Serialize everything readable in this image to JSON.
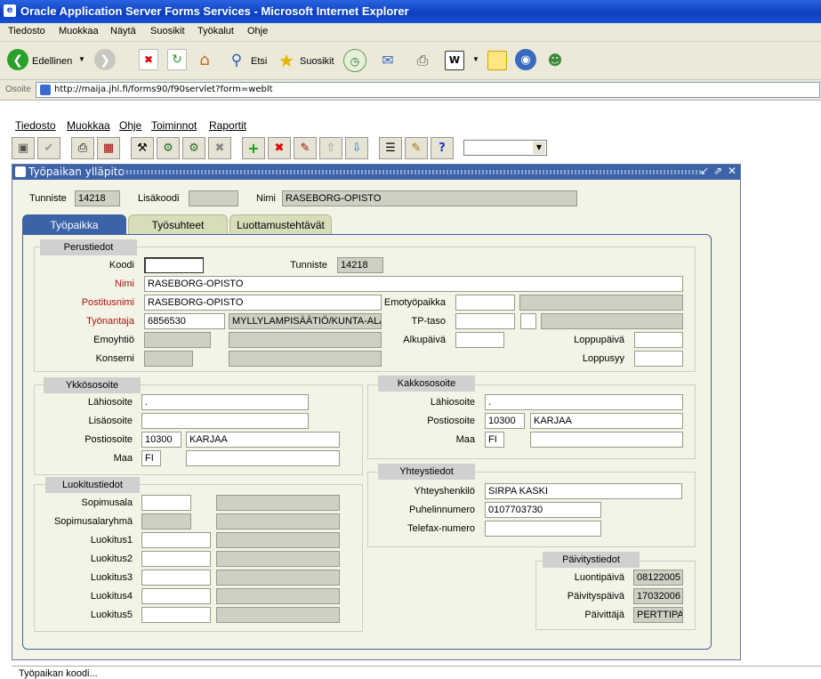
{
  "window": {
    "title": "Oracle Application Server Forms Services - Microsoft Internet Explorer"
  },
  "ie_menu": [
    "Tiedosto",
    "Muokkaa",
    "Näytä",
    "Suosikit",
    "Työkalut",
    "Ohje"
  ],
  "ie_toolbar": {
    "back": "Edellinen",
    "search": "Etsi",
    "favorites": "Suosikit"
  },
  "address": {
    "label": "Osoite",
    "url": "http://maija.jhl.fi/forms90/f90servlet?form=weblt"
  },
  "forms_menu": [
    {
      "label": "Tiedosto"
    },
    {
      "label": "Muokkaa"
    },
    {
      "label": "Ohje"
    },
    {
      "label": "Toiminnot"
    },
    {
      "label": "Raportit"
    }
  ],
  "form": {
    "title": "Työpaikan ylläpito",
    "header": {
      "tunniste_label": "Tunniste",
      "tunniste": "14218",
      "lisakoodi_label": "Lisäkoodi",
      "lisakoodi": "",
      "nimi_label": "Nimi",
      "nimi": "RASEBORG-OPISTO"
    },
    "tabs": [
      "Työpaikka",
      "Työsuhteet",
      "Luottamustehtävät"
    ],
    "perustiedot": {
      "title": "Perustiedot",
      "koodi_label": "Koodi",
      "koodi": "",
      "tunniste_label": "Tunniste",
      "tunniste": "14218",
      "nimi_label": "Nimi",
      "nimi": "RASEBORG-OPISTO",
      "postitusnimi_label": "Postitusnimi",
      "postitusnimi": "RASEBORG-OPISTO",
      "emotyopaikka_label": "Emotyöpaikka",
      "tyonantaja_label": "Työnantaja",
      "tyonantaja": "6856530",
      "tyonantaja_nimi": "MYLLYLAMPISÄÄTIÖ/KUNTA-ALA",
      "tptaso_label": "TP-taso",
      "emoyhtio_label": "Emoyhtiö",
      "alkupaiva_label": "Alkupäivä",
      "loppupaiva_label": "Loppupäivä",
      "konserni_label": "Konserni",
      "loppusyy_label": "Loppusyy"
    },
    "ykkososoite": {
      "title": "Ykkösosoite",
      "lahiosoite_label": "Lähiosoite",
      "lahiosoite": ".",
      "lisaosoite_label": "Lisäosoite",
      "lisaosoite": "",
      "postiosoite_label": "Postiosoite",
      "postinumero": "10300",
      "postitoimipaikka": "KARJAA",
      "maa_label": "Maa",
      "maa": "FI"
    },
    "kakkososoite": {
      "title": "Kakkososoite",
      "lahiosoite_label": "Lähiosoite",
      "lahiosoite": ".",
      "postiosoite_label": "Postiosoite",
      "postinumero": "10300",
      "postitoimipaikka": "KARJAA",
      "maa_label": "Maa",
      "maa": "FI"
    },
    "yhteystiedot": {
      "title": "Yhteystiedot",
      "yhteyshenkilo_label": "Yhteyshenkilö",
      "yhteyshenkilo": "SIRPA KASKI",
      "puhelin_label": "Puhelinnumero",
      "puhelin": "0107703730",
      "telefax_label": "Telefax-numero",
      "telefax": ""
    },
    "luokitustiedot": {
      "title": "Luokitustiedot",
      "sopimusala_label": "Sopimusala",
      "sopimusalaryhma_label": "Sopimusalaryhmä",
      "luokitus1_label": "Luokitus1",
      "luokitus2_label": "Luokitus2",
      "luokitus3_label": "Luokitus3",
      "luokitus4_label": "Luokitus4",
      "luokitus5_label": "Luokitus5"
    },
    "paivitystiedot": {
      "title": "Päivitystiedot",
      "luontipaiva_label": "Luontipäivä",
      "luontipaiva": "08122005",
      "paivityspaiva_label": "Päivityspäivä",
      "paivityspaiva": "17032006",
      "paivittaja_label": "Päivittäjä",
      "paivittaja": "PERTTIPA"
    }
  },
  "status": {
    "text": "Työpaikan koodi..."
  }
}
